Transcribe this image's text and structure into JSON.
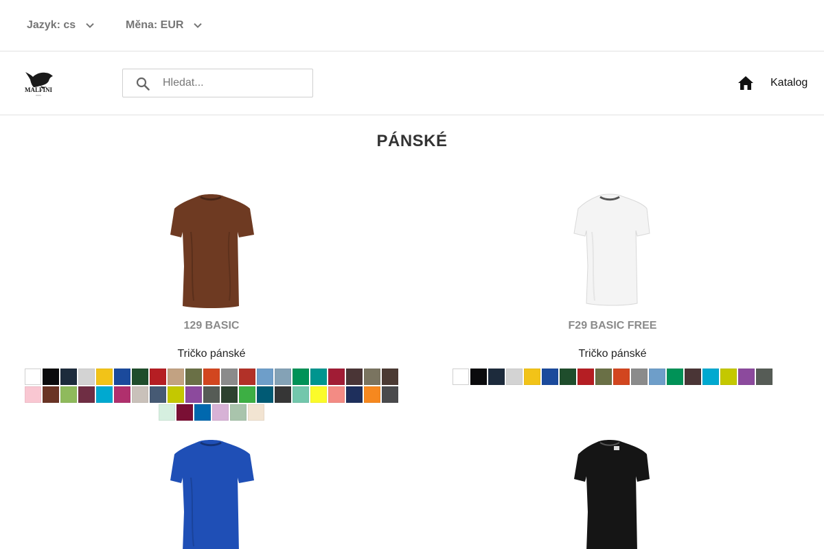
{
  "top_bar": {
    "language_label": "Jazyk: cs",
    "currency_label": "Měna: EUR"
  },
  "header": {
    "logo_text": "MALFINI",
    "search_placeholder": "Hledat...",
    "home_icon": "home-icon",
    "catalog_label": "Katalog"
  },
  "page": {
    "title": "PÁNSKÉ"
  },
  "products": [
    {
      "name": "129 BASIC",
      "description": "Tričko pánské",
      "shirt_color": "#6e3a22",
      "swatches": [
        "#ffffff",
        "#0b0b0d",
        "#1d2b3c",
        "#d3d3d3",
        "#f2c318",
        "#1b4a9c",
        "#1f4d2c",
        "#b51e23",
        "#c2a282",
        "#6a7046",
        "#d2461f",
        "#8b8b8b",
        "#b23128",
        "#6e9ec9",
        "#84a2b6",
        "#009257",
        "#00958f",
        "#a11c35",
        "#4a3536",
        "#7a7460",
        "#4b3a33",
        "#f9c7d2",
        "#6a3425",
        "#8fba5c",
        "#6f2e44",
        "#00a9d0",
        "#b0306d",
        "#c9c1ba",
        "#465a74",
        "#c4c800",
        "#8c4a9d",
        "#565c56",
        "#2d412f",
        "#3daf44",
        "#005a74",
        "#363636",
        "#73c7ac",
        "#fbfb2a",
        "#f38b84",
        "#1e2f5c",
        "#f6881f",
        "#4a4a4c",
        "#d6efe0",
        "#7a0f34",
        "#0068ae",
        "#d7b2d6",
        "#a9c4ac",
        "#f2e4d2"
      ]
    },
    {
      "name": "F29 BASIC FREE",
      "description": "Tričko pánské",
      "shirt_color": "#f4f4f4",
      "swatches": [
        "#ffffff",
        "#0b0b0d",
        "#1d2b3c",
        "#d3d3d3",
        "#f2c318",
        "#1b4a9c",
        "#1f4d2c",
        "#b51e23",
        "#6a7046",
        "#d2461f",
        "#8b8b8b",
        "#6e9ec9",
        "#009257",
        "#4a3536",
        "#00a9d0",
        "#c4c800",
        "#8c4a9d",
        "#565c56"
      ]
    },
    {
      "name": "",
      "description": "",
      "shirt_color": "#1f4fb6",
      "swatches": []
    },
    {
      "name": "",
      "description": "",
      "shirt_color": "#151515",
      "swatches": []
    }
  ]
}
